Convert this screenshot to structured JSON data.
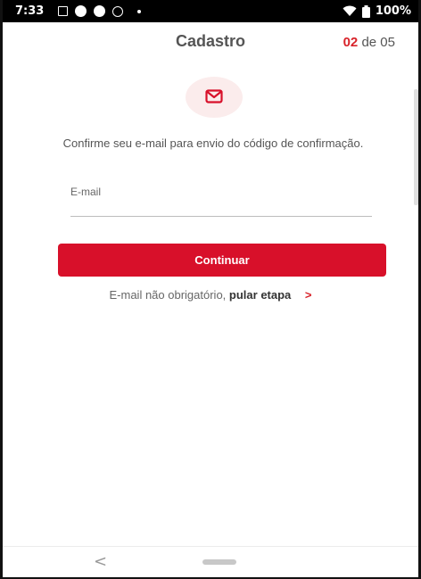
{
  "status_bar": {
    "time": "7:33",
    "battery": "100%",
    "icons": [
      "sim-icon",
      "record-icon",
      "info-icon",
      "sync-icon",
      "dot-icon",
      "wifi-icon",
      "battery-icon"
    ]
  },
  "header": {
    "title": "Cadastro",
    "step_current": "02",
    "step_total": "de 05"
  },
  "email_icon": "envelope-icon",
  "instructions": "Confirme seu e-mail para envio do código de confirmação.",
  "form": {
    "email_label": "E-mail",
    "email_value": "",
    "email_placeholder": ""
  },
  "continue_button": "Continuar",
  "skip": {
    "prefix": "E-mail não obrigatório,",
    "link": "pular etapa",
    "chevron": ">"
  },
  "nav": {
    "back": "<"
  },
  "colors": {
    "accent": "#d8102a",
    "badge_bg": "#fbecec"
  }
}
